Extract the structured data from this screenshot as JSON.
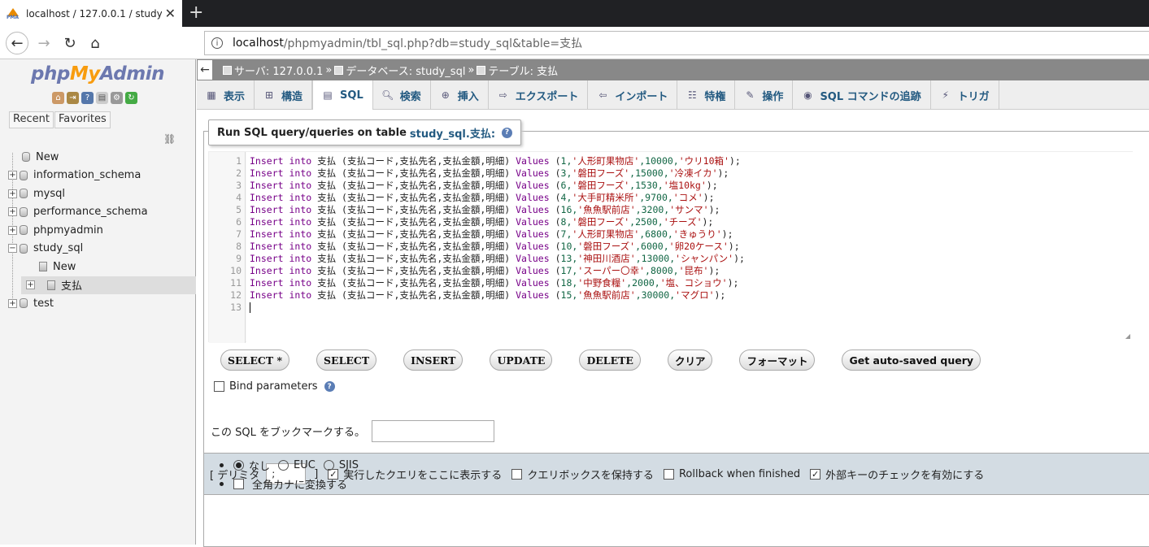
{
  "browser": {
    "tab_title": "localhost / 127.0.0.1 / study_sql",
    "tab_favicon": "PMA",
    "url_host": "localhost",
    "url_path": "/phpmyadmin/tbl_sql.php?db=study_sql&table=支払"
  },
  "left": {
    "logo_php": "php",
    "logo_my": "My",
    "logo_admin": "Admin",
    "recent": "Recent",
    "favorites": "Favorites",
    "tree": [
      "New",
      "information_schema",
      "mysql",
      "performance_schema",
      "phpmyadmin",
      "study_sql",
      "New",
      "支払",
      "test"
    ]
  },
  "breadcrumb": {
    "server": "サーバ: 127.0.0.1",
    "database": "データベース: study_sql",
    "table": "テーブル: 支払",
    "sep": "»"
  },
  "tabs": [
    "表示",
    "構造",
    "SQL",
    "検索",
    "挿入",
    "エクスポート",
    "インポート",
    "特権",
    "操作",
    "SQL コマンドの追跡",
    "トリガ"
  ],
  "legend": {
    "prefix": "Run SQL query/queries on table",
    "table": "study_sql.支払:"
  },
  "sql_lines": [
    {
      "n": "1",
      "vals": "1,",
      "s1": "'人形町果物店'",
      "num": ",10000,",
      "s2": "'ウリ10箱'"
    },
    {
      "n": "2",
      "vals": "3,",
      "s1": "'磐田フーズ'",
      "num": ",15000,",
      "s2": "'冷凍イカ'"
    },
    {
      "n": "3",
      "vals": "6,",
      "s1": "'磐田フーズ'",
      "num": ",1530,",
      "s2": "'塩10kg'"
    },
    {
      "n": "4",
      "vals": "4,",
      "s1": "'大手町精米所'",
      "num": ",9700,",
      "s2": "'コメ'"
    },
    {
      "n": "5",
      "vals": "16,",
      "s1": "'魚魚駅前店'",
      "num": ",3200,",
      "s2": "'サンマ'"
    },
    {
      "n": "6",
      "vals": "8,",
      "s1": "'磐田フーズ'",
      "num": ",2500,",
      "s2": "'チーズ'"
    },
    {
      "n": "7",
      "vals": "7,",
      "s1": "'人形町果物店'",
      "num": ",6800,",
      "s2": "'きゅうり'"
    },
    {
      "n": "8",
      "vals": "10,",
      "s1": "'磐田フーズ'",
      "num": ",6000,",
      "s2": "'卵20ケース'"
    },
    {
      "n": "9",
      "vals": "13,",
      "s1": "'神田川酒店'",
      "num": ",13000,",
      "s2": "'シャンパン'"
    },
    {
      "n": "10",
      "vals": "17,",
      "s1": "'スーパー〇幸'",
      "num": ",8000,",
      "s2": "'昆布'"
    },
    {
      "n": "11",
      "vals": "18,",
      "s1": "'中野食糧'",
      "num": ",2000,",
      "s2": "'塩、コショウ'"
    },
    {
      "n": "12",
      "vals": "15,",
      "s1": "'魚魚駅前店'",
      "num": ",30000,",
      "s2": "'マグロ'"
    }
  ],
  "sql_common": {
    "insert": "Insert",
    "into": "into",
    "table_cols": "支払 (支払コード,支払先名,支払金額,明細)",
    "values": "Values",
    "open": "(",
    "close": ");",
    "last_line": "13"
  },
  "buttons": [
    "SELECT *",
    "SELECT",
    "INSERT",
    "UPDATE",
    "DELETE",
    "クリア",
    "フォーマット",
    "Get auto-saved query"
  ],
  "bind_params": "Bind parameters",
  "bookmark_label": "この SQL をブックマークする。",
  "options": {
    "delimiter_open": "[ デリミタ",
    "delimiter_value": ";",
    "delimiter_close": "]",
    "show_query": "実行したクエリをここに表示する",
    "retain_box": "クエリボックスを保持する",
    "rollback": "Rollback when finished",
    "fk_check": "外部キーのチェックを有効にする"
  },
  "encoding": {
    "none": "なし",
    "euc": "EUC",
    "sjis": "SJIS",
    "kana": "全角カナに変換する"
  }
}
